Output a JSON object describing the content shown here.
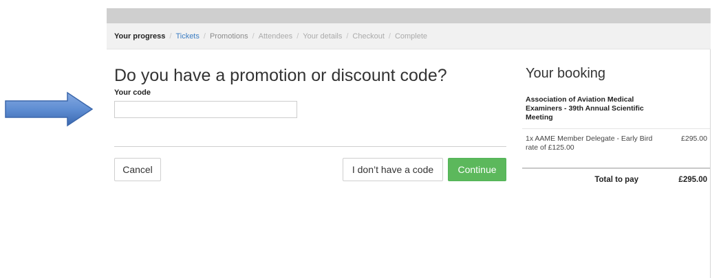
{
  "progress": {
    "label": "Your progress",
    "steps": [
      "Tickets",
      "Promotions",
      "Attendees",
      "Your details",
      "Checkout",
      "Complete"
    ],
    "separator": "/",
    "current_step": "Promotions"
  },
  "promo": {
    "heading": "Do you have a promotion or discount code?",
    "code_label": "Your code",
    "code_value": "",
    "code_placeholder": ""
  },
  "actions": {
    "cancel_label": "Cancel",
    "no_code_label": "I don’t have a code",
    "continue_label": "Continue"
  },
  "booking": {
    "title": "Your booking",
    "event_name": "Association of Aviation Medical Examiners - 39th Annual Scientific Meeting",
    "items": [
      {
        "description": "1x AAME Member Delegate - Early Bird rate of £125.00",
        "price": "£295.00"
      }
    ],
    "total_label": "Total to pay",
    "total_value": "£295.00"
  },
  "colors": {
    "accent_link": "#3a7cc2",
    "continue_green": "#5cb85c",
    "arrow_blue": "#4d7fc7"
  },
  "icons": {
    "pointer": "arrow-right-icon"
  }
}
